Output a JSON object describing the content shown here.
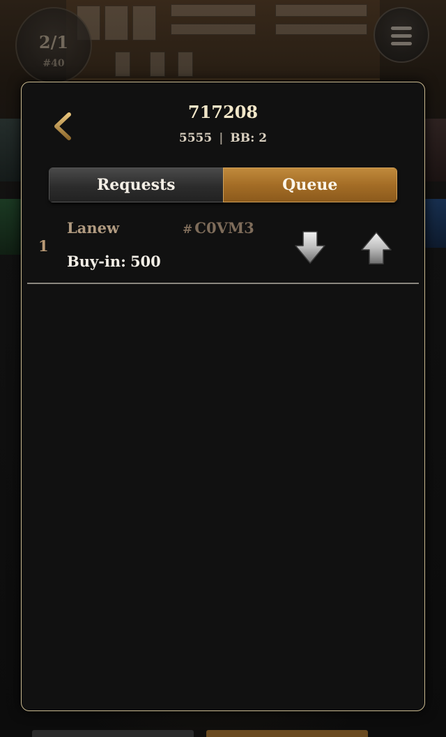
{
  "hud": {
    "blinds": "2/1",
    "table_number": "#40",
    "menu_icon": "hamburger-menu-icon"
  },
  "modal": {
    "title": "717208",
    "subtitle_left": "5555",
    "subtitle_separator": "|",
    "subtitle_right": "BB: 2",
    "back_icon": "chevron-left-icon"
  },
  "tabs": {
    "requests": {
      "label": "Requests",
      "active": false
    },
    "queue": {
      "label": "Queue",
      "active": true
    }
  },
  "queue": {
    "items": [
      {
        "position": "1",
        "name": "Lanew",
        "player_id_prefix": "#",
        "player_id": "C0VM3",
        "buyin_label": "Buy-in:",
        "buyin_value": "500",
        "move_down_icon": "arrow-down-icon",
        "move_up_icon": "arrow-up-icon"
      }
    ]
  },
  "colors": {
    "modal_border": "#c9b98f",
    "modal_background": "#111111",
    "active_tab": "#a46d26",
    "inactive_tab": "#2c2c2c",
    "accent_text": "#b09a80"
  }
}
